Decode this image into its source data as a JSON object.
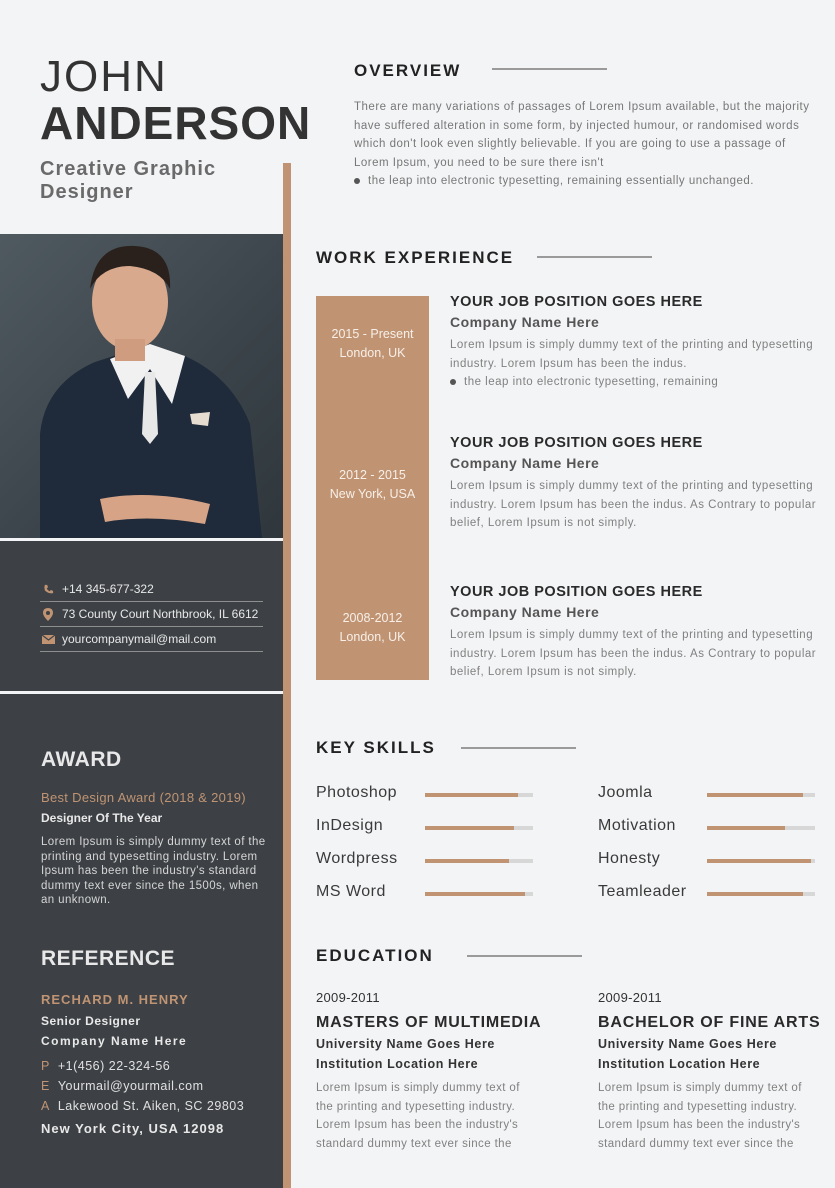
{
  "header": {
    "first_name": "JOHN",
    "last_name": "ANDERSON",
    "role": "Creative Graphic Designer"
  },
  "contact": {
    "phone": "+14 345-677-322",
    "address": "73 County Court Northbrook, IL 6612",
    "email": "yourcompanymail@mail.com",
    "icons": [
      "phone-icon",
      "location-pin-icon",
      "mail-icon"
    ]
  },
  "award": {
    "title": "AWARD",
    "name": "Best Design Award (2018 & 2019)",
    "subtitle": "Designer Of The Year",
    "text": "Lorem Ipsum is simply dummy text of the printing and typesetting industry. Lorem Ipsum has been the industry's standard dummy text ever since the 1500s, when an unknown."
  },
  "reference": {
    "title": "REFERENCE",
    "name": "RECHARD M. HENRY",
    "role": "Senior Designer",
    "company": "Company Name Here",
    "phone_label": "P",
    "phone": "+1(456) 22-324-56",
    "email_label": "E",
    "email": "Yourmail@yourmail.com",
    "address_label": "A",
    "address": "Lakewood St. Aiken, SC 29803",
    "city": "New York City, USA 12098"
  },
  "overview": {
    "title": "OVERVIEW",
    "text": "There are many variations of passages of Lorem Ipsum available, but the majority have suffered alteration in some form, by injected humour, or randomised words which don't look even slightly believable. If you are going to use a passage of Lorem Ipsum, you need to be sure there isn't",
    "bullet": "the leap into electronic typesetting, remaining essentially unchanged."
  },
  "work": {
    "title": "WORK EXPERIENCE",
    "jobs": [
      {
        "dates": "2015 - Present",
        "location": "London, UK",
        "title": "YOUR JOB POSITION GOES HERE",
        "company": "Company Name Here",
        "desc": "Lorem Ipsum is simply dummy text of the printing and typesetting industry. Lorem Ipsum has been the indus.",
        "bullet": "the leap into electronic typesetting, remaining"
      },
      {
        "dates": "2012 - 2015",
        "location": "New York, USA",
        "title": "YOUR JOB POSITION GOES HERE",
        "company": "Company Name Here",
        "desc": "Lorem Ipsum is simply dummy text of the printing and typesetting industry. Lorem Ipsum has been the indus. As Contrary to popular belief, Lorem Ipsum is not simply."
      },
      {
        "dates": "2008-2012",
        "location": "London, UK",
        "title": "YOUR JOB POSITION GOES HERE",
        "company": "Company Name Here",
        "desc": "Lorem Ipsum is simply dummy text of the printing and typesetting industry. Lorem Ipsum has been the indus. As Contrary to popular belief, Lorem Ipsum is not simply."
      }
    ]
  },
  "skills": {
    "title": "KEY SKILLS",
    "items": [
      {
        "name": "Photoshop",
        "level": 0.86
      },
      {
        "name": "Joomla",
        "level": 0.89
      },
      {
        "name": "InDesign",
        "level": 0.82
      },
      {
        "name": "Motivation",
        "level": 0.72
      },
      {
        "name": "Wordpress",
        "level": 0.78
      },
      {
        "name": "Honesty",
        "level": 0.96
      },
      {
        "name": "MS Word",
        "level": 0.93
      },
      {
        "name": "Teamleader",
        "level": 0.89
      }
    ]
  },
  "education": {
    "title": "EDUCATION",
    "items": [
      {
        "years": "2009-2011",
        "degree": "MASTERS OF MULTIMEDIA",
        "university": "University Name Goes Here",
        "location": "Institution Location Here",
        "desc": "Lorem Ipsum is simply dummy text of the printing and typesetting industry. Lorem Ipsum has been the industry's standard dummy text ever since the"
      },
      {
        "years": "2009-2011",
        "degree": "BACHELOR OF FINE ARTS",
        "university": "University Name Goes Here",
        "location": "Institution Location Here",
        "desc": "Lorem Ipsum is simply dummy text of the printing and typesetting industry. Lorem Ipsum has been the industry's standard dummy text ever since the"
      }
    ]
  },
  "colors": {
    "accent": "#c09473",
    "dark_panel": "#3d4145",
    "background": "#f3f4f6"
  }
}
